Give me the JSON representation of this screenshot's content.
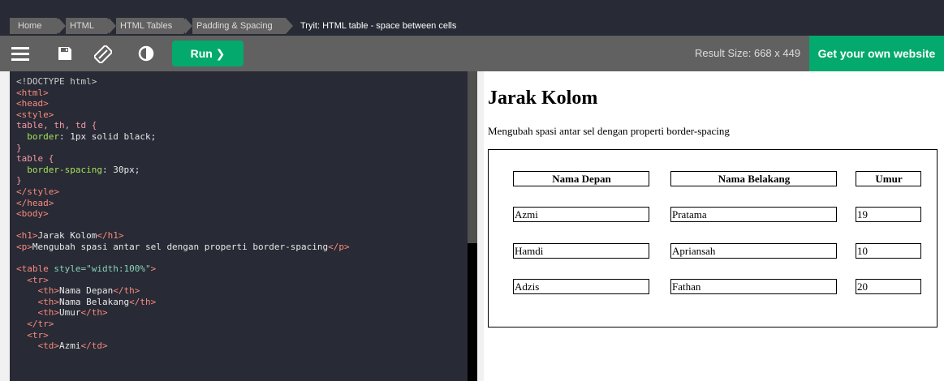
{
  "breadcrumb": {
    "items": [
      "Home",
      "HTML",
      "HTML Tables",
      "Padding & Spacing"
    ],
    "current": "Tryit: HTML table - space between cells"
  },
  "toolbar": {
    "icons": [
      "menu-icon",
      "save-icon",
      "orientation-icon",
      "contrast-icon"
    ],
    "run_label": "Run ❯",
    "result_size": "Result Size: 668 x 449",
    "own_website_label": "Get your own website"
  },
  "editor": {
    "lines": [
      [
        [
          "p",
          "<!DOCTYPE html>"
        ]
      ],
      [
        [
          "t",
          "<html>"
        ]
      ],
      [
        [
          "t",
          "<head>"
        ]
      ],
      [
        [
          "t",
          "<style>"
        ]
      ],
      [
        [
          "s",
          "table, th, td {"
        ]
      ],
      [
        [
          "w",
          "  "
        ],
        [
          "k",
          "border"
        ],
        [
          "w",
          ": 1px solid black;"
        ]
      ],
      [
        [
          "s",
          "}"
        ]
      ],
      [
        [
          "s",
          "table {"
        ]
      ],
      [
        [
          "w",
          "  "
        ],
        [
          "k",
          "border-spacing"
        ],
        [
          "w",
          ": 30px;"
        ]
      ],
      [
        [
          "s",
          "}"
        ]
      ],
      [
        [
          "t",
          "</style>"
        ]
      ],
      [
        [
          "t",
          "</head>"
        ]
      ],
      [
        [
          "t",
          "<body>"
        ]
      ],
      [
        [
          "w",
          ""
        ]
      ],
      [
        [
          "t",
          "<h1>"
        ],
        [
          "w",
          "Jarak Kolom"
        ],
        [
          "t",
          "</h1>"
        ]
      ],
      [
        [
          "t",
          "<p>"
        ],
        [
          "w",
          "Mengubah spasi antar sel dengan properti border-spacing"
        ],
        [
          "t",
          "</p>"
        ]
      ],
      [
        [
          "w",
          ""
        ]
      ],
      [
        [
          "t",
          "<table "
        ],
        [
          "a",
          "style=\"width:100%\""
        ],
        [
          "t",
          ">"
        ]
      ],
      [
        [
          "w",
          "  "
        ],
        [
          "t",
          "<tr>"
        ]
      ],
      [
        [
          "w",
          "    "
        ],
        [
          "t",
          "<th>"
        ],
        [
          "w",
          "Nama Depan"
        ],
        [
          "t",
          "</th>"
        ]
      ],
      [
        [
          "w",
          "    "
        ],
        [
          "t",
          "<th>"
        ],
        [
          "w",
          "Nama Belakang"
        ],
        [
          "t",
          "</th>"
        ]
      ],
      [
        [
          "w",
          "    "
        ],
        [
          "t",
          "<th>"
        ],
        [
          "w",
          "Umur"
        ],
        [
          "t",
          "</th>"
        ]
      ],
      [
        [
          "w",
          "  "
        ],
        [
          "t",
          "</tr>"
        ]
      ],
      [
        [
          "w",
          "  "
        ],
        [
          "t",
          "<tr>"
        ]
      ],
      [
        [
          "w",
          "    "
        ],
        [
          "t",
          "<td>"
        ],
        [
          "w",
          "Azmi"
        ],
        [
          "t",
          "</td>"
        ]
      ]
    ]
  },
  "colors": {
    "tag": "#f88c7e",
    "selector": "#f49ba6",
    "property": "#a3e05b",
    "attribute": "#88d4b8",
    "doctype": "#cccccc",
    "plain": "#e8e8e8"
  },
  "result": {
    "heading": "Jarak Kolom",
    "paragraph": "Mengubah spasi antar sel dengan properti border-spacing",
    "headers": [
      "Nama Depan",
      "Nama Belakang",
      "Umur"
    ],
    "rows": [
      [
        "Azmi",
        "Pratama",
        "19"
      ],
      [
        "Hamdi",
        "Apriansah",
        "10"
      ],
      [
        "Adzis",
        "Fathan",
        "20"
      ]
    ]
  }
}
